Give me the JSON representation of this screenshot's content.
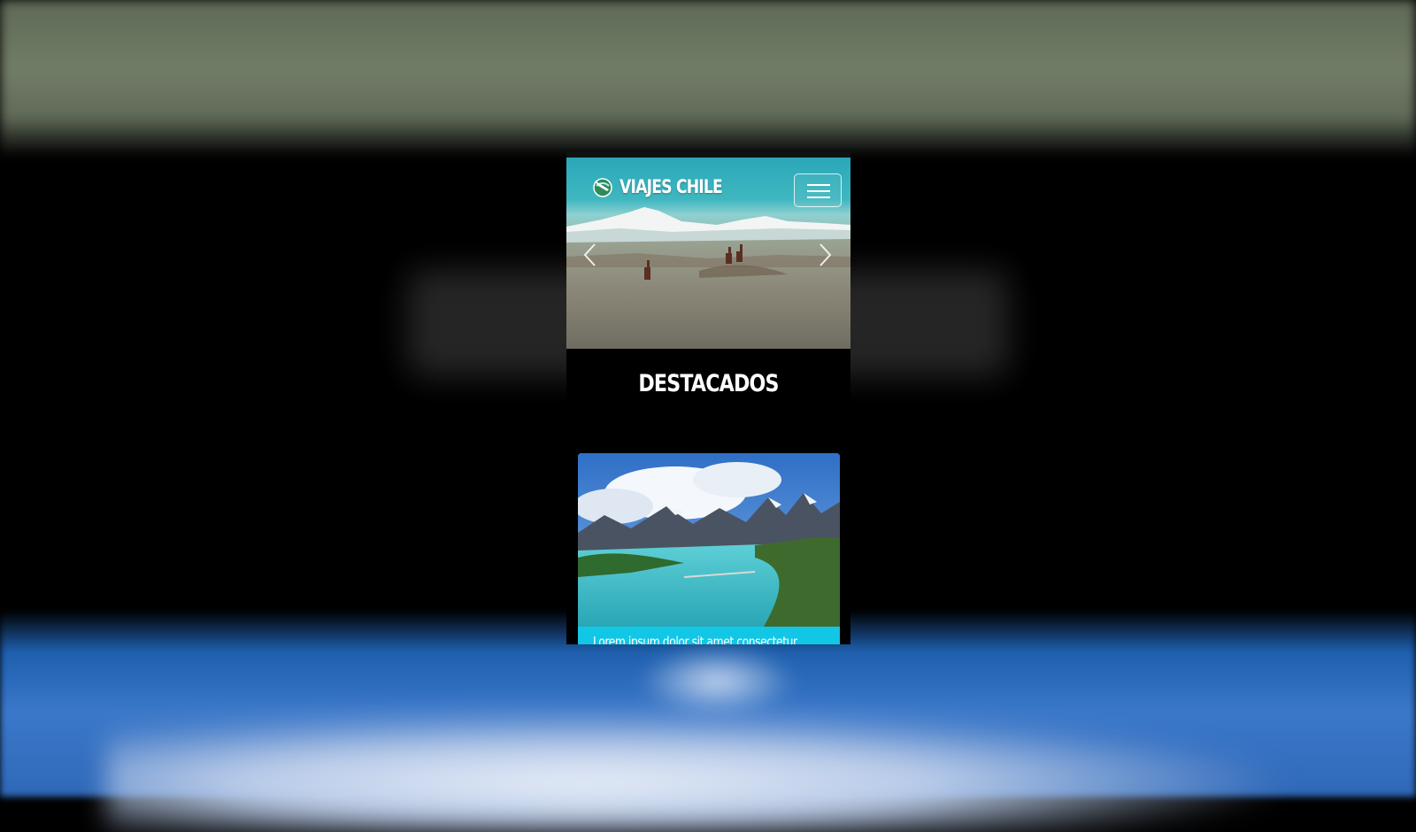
{
  "navbar": {
    "brand_name": "VIAJES CHILE",
    "brand_logo_icon": "globe-plane-logo-icon",
    "menu_icon": "hamburger-menu-icon"
  },
  "carousel": {
    "prev_icon": "chevron-left-icon",
    "next_icon": "chevron-right-icon",
    "slide_subject": "llamas-altiplano-volcano"
  },
  "featured": {
    "title": "DESTACADOS",
    "cards": [
      {
        "image_subject": "torres-del-paine-lake",
        "text": "Lorem ipsum dolor sit amet consectetur"
      }
    ]
  },
  "colors": {
    "card_accent": "#12c6e6",
    "page_background": "#000000",
    "text": "#ffffff"
  }
}
